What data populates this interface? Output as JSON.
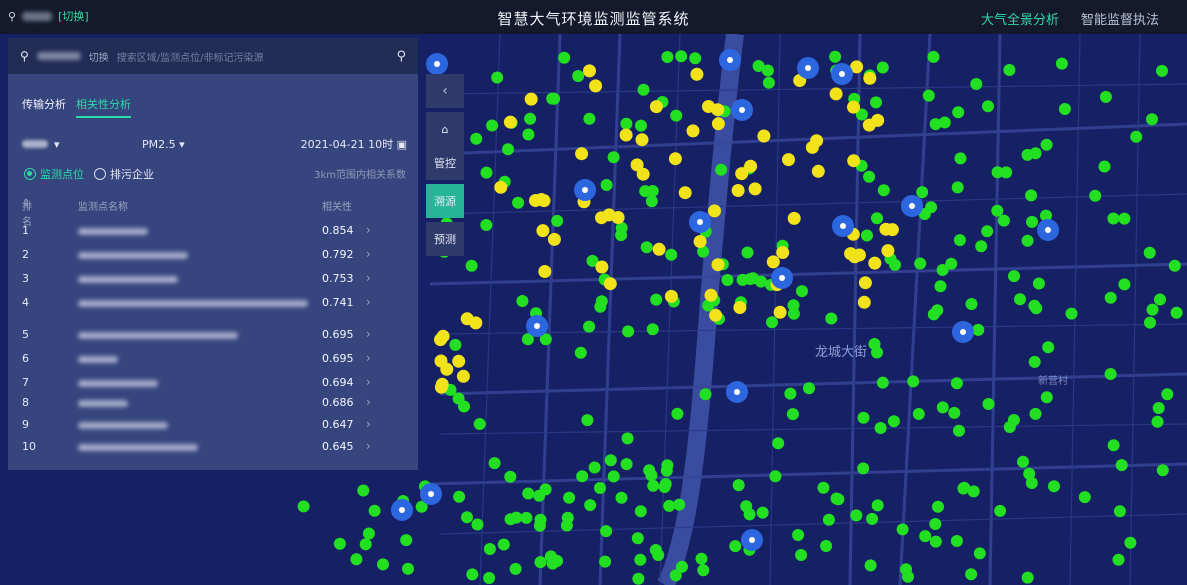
{
  "topbar": {
    "location_switch": "[切换]",
    "title": "智慧大气环境监测监管系统",
    "nav": [
      {
        "label": "大气全景分析",
        "active": true
      },
      {
        "label": "智能监督执法",
        "active": false
      }
    ]
  },
  "search": {
    "switch_label": "切换",
    "placeholder": "搜索区域/监测点位/非标记污染源"
  },
  "tabs": [
    {
      "label": "传输分析",
      "active": false
    },
    {
      "label": "相关性分析",
      "active": true
    }
  ],
  "filters": {
    "pollutant": "PM2.5",
    "datetime": "2021-04-21 10时"
  },
  "radios": [
    {
      "label": "监测点位",
      "checked": true
    },
    {
      "label": "排污企业",
      "checked": false
    }
  ],
  "note": "3km范围内相关系数",
  "table": {
    "headers": {
      "rank": "排名",
      "name": "监测点名称",
      "corr": "相关性"
    },
    "rows": [
      {
        "rank": "1",
        "value": "0.854"
      },
      {
        "rank": "2",
        "value": "0.792"
      },
      {
        "rank": "3",
        "value": "0.753"
      },
      {
        "rank": "4",
        "value": "0.741"
      },
      {
        "rank": "5",
        "value": "0.695"
      },
      {
        "rank": "6",
        "value": "0.695"
      },
      {
        "rank": "7",
        "value": "0.694"
      },
      {
        "rank": "8",
        "value": "0.686"
      },
      {
        "rank": "9",
        "value": "0.647"
      },
      {
        "rank": "10",
        "value": "0.645"
      }
    ]
  },
  "side_buttons": [
    {
      "label": "管控",
      "active": false
    },
    {
      "label": "溯源",
      "active": true
    },
    {
      "label": "预测",
      "active": false
    }
  ],
  "map": {
    "district_label": "龙城大街",
    "village_label": "新营村"
  },
  "colors": {
    "accent": "#2fd9a6",
    "marker_green": "#22e021",
    "marker_yellow": "#f2e21a",
    "marker_blue": "#2d67e0",
    "map_bg": "#162064"
  }
}
